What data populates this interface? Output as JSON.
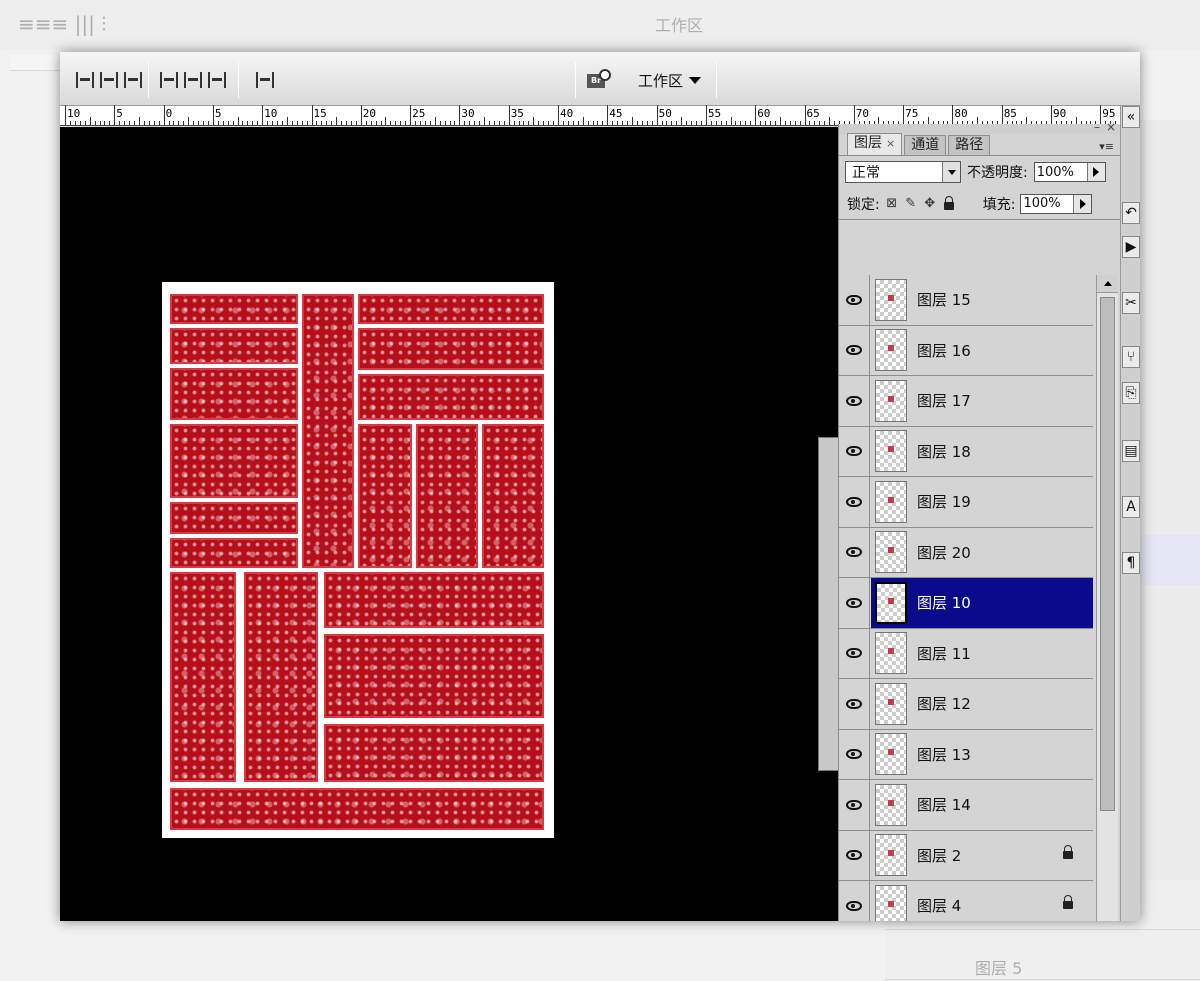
{
  "workspace": {
    "label": "工作区"
  },
  "bridge": {
    "label": "Br"
  },
  "ruler": {
    "labels": [
      "10",
      "5",
      "0",
      "5",
      "10",
      "15",
      "20",
      "25",
      "30",
      "35",
      "40",
      "45",
      "50",
      "55",
      "60",
      "65",
      "70",
      "75",
      "80",
      "85",
      "90",
      "95"
    ]
  },
  "panel": {
    "tabs": [
      {
        "label": "图层",
        "close": "×"
      },
      {
        "label": "通道"
      },
      {
        "label": "路径"
      }
    ],
    "blend_mode": "正常",
    "opacity_label": "不透明度:",
    "opacity_value": "100%",
    "lock_label": "锁定:",
    "fill_label": "填充:",
    "fill_value": "100%"
  },
  "layers": [
    {
      "name": "图层 15",
      "visible": true,
      "selected": false,
      "locked": false
    },
    {
      "name": "图层 16",
      "visible": true,
      "selected": false,
      "locked": false
    },
    {
      "name": "图层 17",
      "visible": true,
      "selected": false,
      "locked": false
    },
    {
      "name": "图层 18",
      "visible": true,
      "selected": false,
      "locked": false
    },
    {
      "name": "图层 19",
      "visible": true,
      "selected": false,
      "locked": false
    },
    {
      "name": "图层 20",
      "visible": true,
      "selected": false,
      "locked": false
    },
    {
      "name": "图层 10",
      "visible": true,
      "selected": true,
      "locked": false
    },
    {
      "name": "图层 11",
      "visible": true,
      "selected": false,
      "locked": false
    },
    {
      "name": "图层 12",
      "visible": true,
      "selected": false,
      "locked": false
    },
    {
      "name": "图层 13",
      "visible": true,
      "selected": false,
      "locked": false
    },
    {
      "name": "图层 14",
      "visible": true,
      "selected": false,
      "locked": false
    },
    {
      "name": "图层 2",
      "visible": true,
      "selected": false,
      "locked": true
    },
    {
      "name": "图层 4",
      "visible": true,
      "selected": false,
      "locked": true
    },
    {
      "name": "图层 5",
      "visible": true,
      "selected": false,
      "locked": true
    }
  ],
  "background_echo": {
    "layer_label": "图层 5",
    "workspace_label": "工作区"
  },
  "colors": {
    "selection": "#0a0a8c",
    "pattern_red": "#b70f1a",
    "canvas": "#000000"
  }
}
